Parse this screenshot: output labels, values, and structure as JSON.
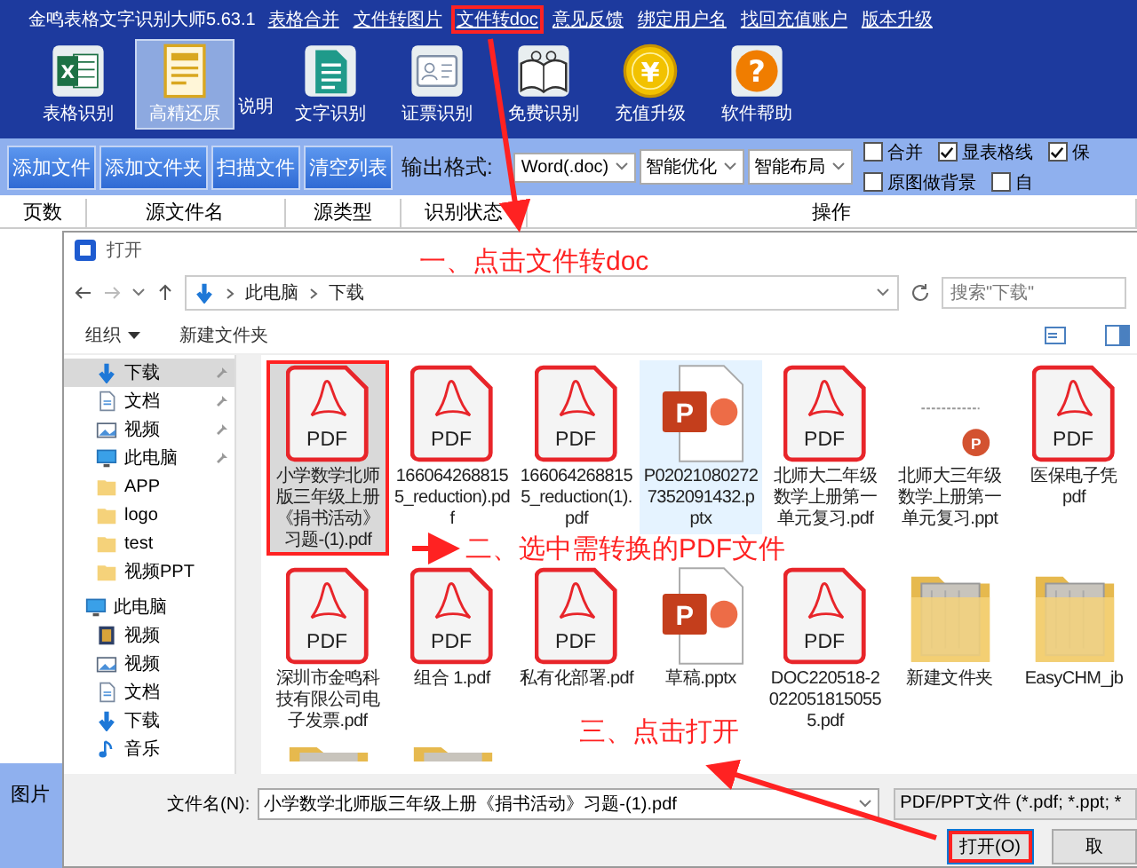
{
  "app": {
    "title": "金鸣表格文字识别大师5.63.1",
    "menu": [
      {
        "label": "表格合并",
        "highlighted": false
      },
      {
        "label": "文件转图片",
        "highlighted": false
      },
      {
        "label": "文件转doc",
        "highlighted": true
      },
      {
        "label": "意见反馈",
        "highlighted": false
      },
      {
        "label": "绑定用户名",
        "highlighted": false
      },
      {
        "label": "找回充值账户",
        "highlighted": false
      },
      {
        "label": "版本升级",
        "highlighted": false
      }
    ]
  },
  "toolbar": [
    {
      "label": "表格识别",
      "kind": "excel",
      "glyph": "X",
      "selected": false
    },
    {
      "label": "高精还原",
      "kind": "layout",
      "selected": true
    },
    {
      "label": "文字识别",
      "kind": "page",
      "selected": false
    },
    {
      "label": "证票识别",
      "kind": "card",
      "selected": false
    },
    {
      "label": "免费识别",
      "kind": "book",
      "selected": false
    },
    {
      "label": "充值升级",
      "kind": "coin",
      "glyph": "¥",
      "selected": false
    },
    {
      "label": "软件帮助",
      "kind": "help",
      "glyph": "?",
      "selected": false
    }
  ],
  "toolbar_note": "说明",
  "actions": [
    {
      "label": "添加文件"
    },
    {
      "label": "添加文件夹"
    },
    {
      "label": "扫描文件"
    },
    {
      "label": "清空列表"
    }
  ],
  "output_format": {
    "label": "输出格式:",
    "selects": [
      {
        "value": "Word(.doc)"
      },
      {
        "value": "智能优化"
      },
      {
        "value": "智能布局"
      }
    ]
  },
  "options": [
    [
      {
        "label": "合并",
        "checked": false
      },
      {
        "label": "显表格线",
        "checked": true
      },
      {
        "label": "保",
        "checked": true
      }
    ],
    [
      {
        "label": "原图做背景",
        "checked": false
      },
      {
        "label": "自",
        "checked": false
      }
    ]
  ],
  "table": {
    "columns": [
      "页数",
      "源文件名",
      "源类型",
      "识别状态",
      "操作"
    ]
  },
  "left_panel": {
    "label": "图片"
  },
  "dialog": {
    "title": "打开",
    "path": [
      "此电脑",
      "下载"
    ],
    "search": {
      "placeholder": "搜索\"下载\""
    },
    "commands": [
      {
        "label": "组织",
        "dropdown": true
      },
      {
        "label": "新建文件夹",
        "dropdown": false
      }
    ],
    "nav": [
      {
        "label": "下载",
        "kind": "download",
        "pinned": true,
        "selected": true
      },
      {
        "label": "文档",
        "kind": "doc",
        "pinned": true,
        "selected": false
      },
      {
        "label": "视频",
        "kind": "picture",
        "pinned": true,
        "selected": false
      },
      {
        "label": "此电脑",
        "kind": "pc",
        "pinned": true,
        "selected": false
      },
      {
        "label": "APP",
        "kind": "folder",
        "pinned": false,
        "selected": false
      },
      {
        "label": "logo",
        "kind": "folder",
        "pinned": false,
        "selected": false
      },
      {
        "label": "test",
        "kind": "folder",
        "pinned": false,
        "selected": false
      },
      {
        "label": "视频PPT",
        "kind": "folder",
        "pinned": false,
        "selected": false
      }
    ],
    "this_pc": {
      "label": "此电脑",
      "kind": "pc",
      "selected": false,
      "children": [
        {
          "label": "视频",
          "kind": "film",
          "selected": false
        },
        {
          "label": "视频",
          "kind": "picture",
          "selected": false
        },
        {
          "label": "文档",
          "kind": "doc",
          "selected": false
        },
        {
          "label": "下载",
          "kind": "download",
          "selected": false
        },
        {
          "label": "音乐",
          "kind": "music",
          "selected": false
        }
      ]
    },
    "files": [
      {
        "name": "小学数学北师版三年级上册《捐书活动》习题-(1).pdf",
        "kind": "pdf",
        "icon_label": "PDF",
        "selected": true,
        "hovered": false,
        "highlighted": true
      },
      {
        "name": "1660642688155_reduction).pdf",
        "kind": "pdf",
        "icon_label": "PDF",
        "selected": false,
        "hovered": false,
        "highlighted": false
      },
      {
        "name": "1660642688155_reduction(1).pdf",
        "kind": "pdf",
        "icon_label": "PDF",
        "selected": false,
        "hovered": false,
        "highlighted": false
      },
      {
        "name": "P020210802727352091432.pptx",
        "kind": "pptx",
        "icon_label": "P",
        "selected": false,
        "hovered": true,
        "highlighted": false
      },
      {
        "name": "北师大二年级数学上册第一单元复习.pdf",
        "kind": "pdf",
        "icon_label": "PDF",
        "selected": false,
        "hovered": false,
        "highlighted": false
      },
      {
        "name": "北师大三年级数学上册第一单元复习.ppt",
        "kind": "thumb",
        "icon_label": "P",
        "selected": false,
        "hovered": false,
        "highlighted": false
      },
      {
        "name": "医保电子凭\npdf",
        "kind": "pdf",
        "icon_label": "PDF",
        "selected": false,
        "hovered": false,
        "highlighted": false
      },
      {
        "name": "深圳市金鸣科技有限公司电子发票.pdf",
        "kind": "pdf",
        "icon_label": "PDF",
        "selected": false,
        "hovered": false,
        "highlighted": false
      },
      {
        "name": "组合 1.pdf",
        "kind": "pdf",
        "icon_label": "PDF",
        "selected": false,
        "hovered": false,
        "highlighted": false
      },
      {
        "name": "私有化部署.pdf",
        "kind": "pdf",
        "icon_label": "PDF",
        "selected": false,
        "hovered": false,
        "highlighted": false
      },
      {
        "name": "草稿.pptx",
        "kind": "pptx",
        "icon_label": "P",
        "selected": false,
        "hovered": false,
        "highlighted": false
      },
      {
        "name": "DOC220518-20220518150555.pdf",
        "kind": "pdf",
        "icon_label": "PDF",
        "selected": false,
        "hovered": false,
        "highlighted": false
      },
      {
        "name": "新建文件夹",
        "kind": "folder",
        "selected": false,
        "hovered": false,
        "highlighted": false
      },
      {
        "name": "EasyCHM_jb",
        "kind": "folder",
        "selected": false,
        "hovered": false,
        "highlighted": false
      },
      {
        "kind": "folder",
        "selected": false,
        "hovered": false,
        "highlighted": false
      },
      {
        "kind": "folder",
        "selected": false,
        "hovered": false,
        "highlighted": false
      }
    ],
    "filename_label": "文件名(N):",
    "filename": "小学数学北师版三年级上册《捐书活动》习题-(1).pdf",
    "filter": "PDF/PPT文件 (*.pdf; *.ppt; *",
    "buttons": [
      {
        "label": "打开(O)",
        "default": true,
        "highlighted": true
      },
      {
        "label": "取",
        "default": false,
        "highlighted": false
      }
    ]
  },
  "annotations": [
    {
      "text": "一、点击文件转doc"
    },
    {
      "text": "二、选中需转换的PDF文件"
    },
    {
      "text": "三、点击打开"
    }
  ]
}
